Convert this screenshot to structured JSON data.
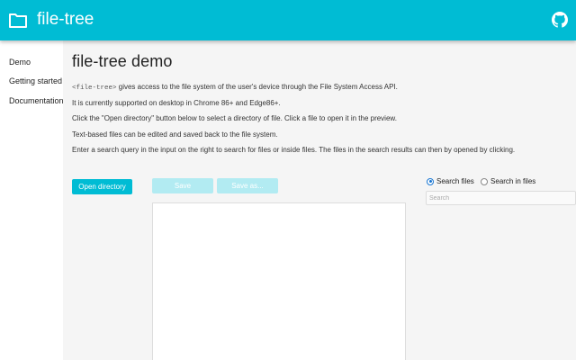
{
  "header": {
    "title": "file-tree",
    "folder_icon": "folder-icon",
    "github_icon": "github-icon",
    "bg_color": "#00bcd4"
  },
  "sidebar": {
    "items": [
      {
        "label": "Demo"
      },
      {
        "label": "Getting started"
      },
      {
        "label": "Documentation"
      }
    ]
  },
  "main": {
    "title": "file-tree demo",
    "intro_code": "<file-tree>",
    "intro_rest": " gives access to the file system of the user's device through the File System Access API.",
    "support_text": "It is currently supported on desktop in Chrome 86+ and Edge86+.",
    "click_text": "Click the \"Open directory\" button below to select a directory of file. Click a file to open it in the preview.",
    "edit_text": "Text-based files can be edited and saved back to the file system.",
    "search_text": "Enter a search query in the input on the right to search for files or inside files. The files in the search results can then by opened by clicking."
  },
  "toolbar": {
    "open_label": "Open directory",
    "save_label": "Save",
    "save_as_label": "Save as..."
  },
  "search": {
    "options": [
      {
        "label": "Search files",
        "checked": true
      },
      {
        "label": "Search in files",
        "checked": false
      }
    ],
    "placeholder": "Search",
    "value": ""
  }
}
